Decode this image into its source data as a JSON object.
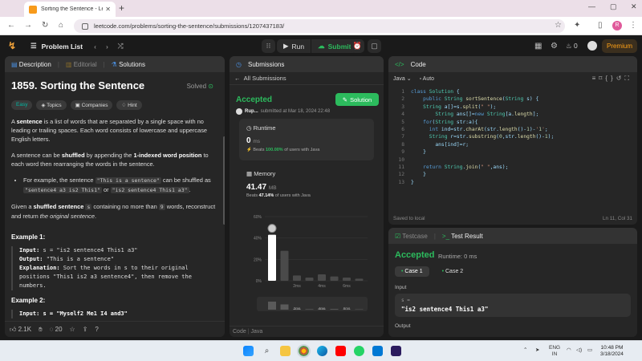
{
  "browser": {
    "tab_title": "Sorting the Sentence - LeetCode",
    "url": "leetcode.com/problems/sorting-the-sentence/submissions/1207437183/",
    "profile_initial": "R"
  },
  "lc_nav": {
    "problem_list": "Problem List",
    "run": "Run",
    "submit": "Submit",
    "streak": "0",
    "premium": "Premium"
  },
  "description": {
    "tab_description": "Description",
    "tab_editorial": "Editorial",
    "tab_solutions": "Solutions",
    "title": "1859. Sorting the Sentence",
    "solved": "Solved",
    "tags": [
      "Easy",
      "Topics",
      "Companies",
      "Hint"
    ],
    "p1_a": "A ",
    "p1_b": "sentence",
    "p1_c": " is a list of words that are separated by a single space with no leading or trailing spaces. Each word consists of lowercase and uppercase English letters.",
    "p2_a": "A sentence can be ",
    "p2_b": "shuffled",
    "p2_c": " by appending the ",
    "p2_d": "1-indexed word position",
    "p2_e": " to each word then rearranging the words in the sentence.",
    "bullet_a": "For example, the sentence ",
    "bullet_code1": "\"This is a sentence\"",
    "bullet_b": " can be shuffled as ",
    "bullet_code2": "\"sentence4 a3 is2 This1\"",
    "bullet_c": " or ",
    "bullet_code3": "\"is2 sentence4 This1 a3\"",
    "bullet_d": ".",
    "p3_a": "Given a ",
    "p3_b": "shuffled sentence",
    "p3_code_s": "s",
    "p3_c": " containing no more than ",
    "p3_code_9": "9",
    "p3_d": " words, reconstruct and return ",
    "p3_e": "the original sentence",
    "p3_f": ".",
    "example1_title": "Example 1:",
    "example1_input_l": "Input:",
    "example1_input": " s = \"is2 sentence4 This1 a3\"",
    "example1_output_l": "Output:",
    "example1_output": " \"This is a sentence\"",
    "example1_expl_l": "Explanation:",
    "example1_expl": " Sort the words in s to their original positions \"This1 is2 a3 sentence4\", then remove the numbers.",
    "example2_title": "Example 2:",
    "example2_input": "Input: s = \"Myself2 Me1 I4 and3\"",
    "likes": "2.1K",
    "comments": "20"
  },
  "submissions": {
    "header": "Submissions",
    "back": "All Submissions",
    "status": "Accepted",
    "user": "Rup...",
    "submitted": "submitted at Mar 18, 2024 22:48",
    "solution_btn": "Solution",
    "runtime_label": "Runtime",
    "runtime_value": "0",
    "runtime_unit": "ms",
    "runtime_beats_a": "Beats ",
    "runtime_beats_pct": "100.00%",
    "runtime_beats_b": " of users with Java",
    "memory_label": "Memory",
    "memory_value": "41.47",
    "memory_unit": "MB",
    "memory_beats_a": "Beats ",
    "memory_beats_pct": "47.14%",
    "memory_beats_b": " of users with Java",
    "footer_code": "Code",
    "footer_lang": "Java"
  },
  "chart_data": {
    "type": "bar",
    "y_ticks": [
      "60%",
      "40%",
      "20%",
      "0%"
    ],
    "x_ticks": [
      "2ms",
      "4ms",
      "6ms"
    ],
    "ylim": [
      0,
      60
    ],
    "values": [
      43,
      28,
      5,
      3,
      6,
      4,
      3,
      2
    ],
    "highlight_index": 0
  },
  "code": {
    "header": "Code",
    "lang": "Java",
    "mode": "Auto",
    "lines": [
      "class Solution {",
      "    public String sortSentence(String s) {",
      "    String a[]=s.split(\" \");",
      "        String ans[]=new String[a.length];",
      "    for(String str:a){",
      "      int ind=str.charAt(str.length()-1)-'1';",
      "      String r=str.substring(0,str.length()-1);",
      "        ans[ind]=r;",
      "    }",
      "",
      "    return String.join(\" \",ans);",
      "    }",
      "}"
    ],
    "saved": "Saved to local",
    "cursor": "Ln 11, Col 31"
  },
  "test": {
    "tab_testcase": "Testcase",
    "tab_result": "Test Result",
    "status": "Accepted",
    "runtime": "Runtime: 0 ms",
    "case1": "Case 1",
    "case2": "Case 2",
    "input_label": "Input",
    "input_key": "s =",
    "input_value": "\"is2 sentence4 This1 a3\"",
    "output_label": "Output"
  },
  "taskbar": {
    "lang": "ENG",
    "region": "IN",
    "time": "10:48 PM",
    "date": "3/18/2024"
  }
}
